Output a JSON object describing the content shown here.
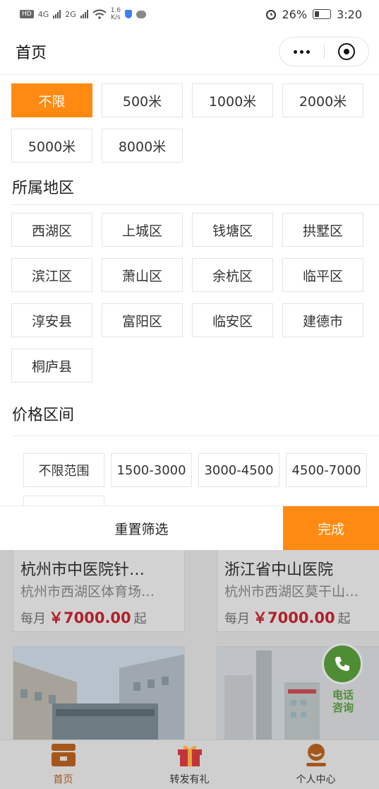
{
  "status_bar": {
    "network_chip": "HD",
    "signal1": "4G",
    "signal2": "2G",
    "speed_value": "1.6",
    "speed_unit": "K/s",
    "battery": "26%",
    "time": "3:20"
  },
  "header": {
    "title": "首页"
  },
  "distance": {
    "options": [
      "不限",
      "500米",
      "1000米",
      "2000米",
      "5000米",
      "8000米"
    ],
    "selected": "不限"
  },
  "region": {
    "title": "所属地区",
    "options": [
      "西湖区",
      "上城区",
      "钱塘区",
      "拱墅区",
      "滨江区",
      "萧山区",
      "余杭区",
      "临平区",
      "淳安县",
      "富阳区",
      "临安区",
      "建德市",
      "桐庐县"
    ]
  },
  "price": {
    "title": "价格区间",
    "options": [
      "不限范围",
      "1500-3000",
      "3000-4500",
      "4500-7000"
    ]
  },
  "actions": {
    "reset_label": "重置筛选",
    "done_label": "完成"
  },
  "listings": [
    {
      "name": "杭州市中医院针…",
      "address": "杭州市西湖区体育场…",
      "price_prefix": "每月",
      "price": "￥7000.00",
      "price_suffix": "起"
    },
    {
      "name": "浙江省中山医院",
      "address": "杭州市西湖区莫干山…",
      "price_prefix": "每月",
      "price": "￥7000.00",
      "price_suffix": "起"
    }
  ],
  "phone_consult": {
    "line1": "电话",
    "line2": "咨询"
  },
  "tabbar": {
    "items": [
      {
        "label": "首页",
        "icon": "home-icon",
        "active": true
      },
      {
        "label": "转发有礼",
        "icon": "gift-icon",
        "active": false
      },
      {
        "label": "个人中心",
        "icon": "user-icon",
        "active": false
      }
    ]
  },
  "colors": {
    "accent": "#ff8a12",
    "price_red": "#b0202a",
    "phone_green": "#4f8d35"
  }
}
